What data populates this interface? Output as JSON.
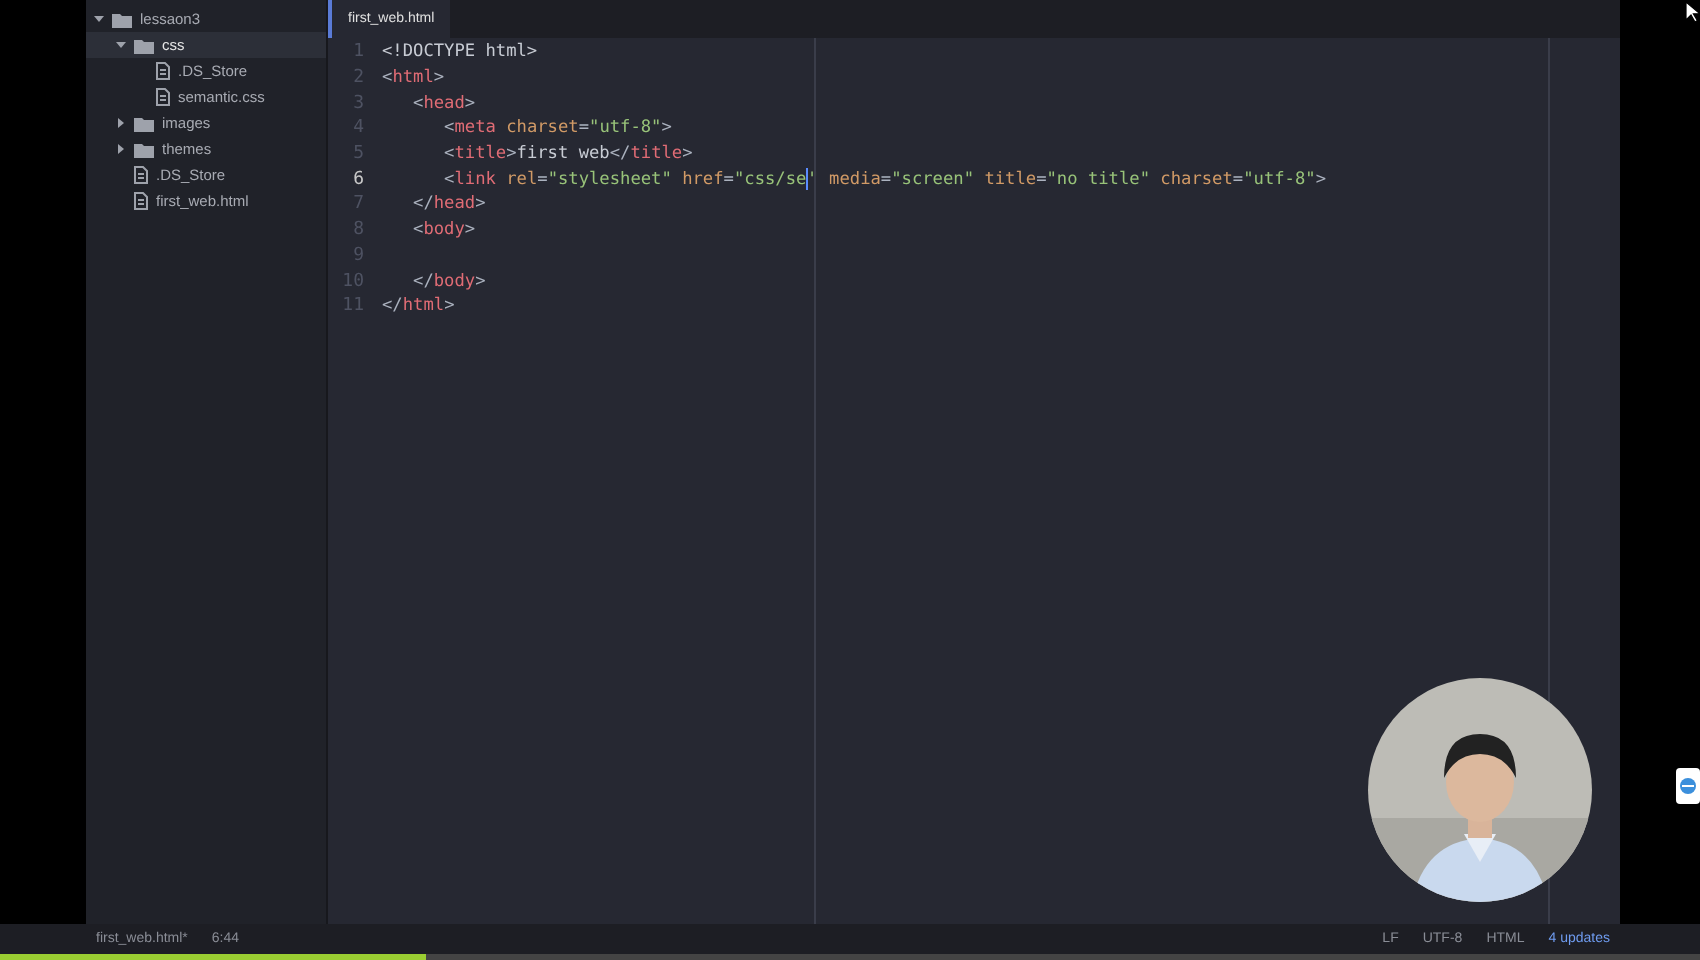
{
  "sidebar": {
    "tree": [
      {
        "label": "lessaon3",
        "kind": "folder",
        "expanded": true,
        "children": [
          {
            "label": "css",
            "kind": "folder",
            "expanded": true,
            "selected": true,
            "children": [
              {
                "label": ".DS_Store",
                "kind": "file",
                "selected": false
              },
              {
                "label": "semantic.css",
                "kind": "file",
                "selected": false
              }
            ]
          },
          {
            "label": "images",
            "kind": "folder",
            "expanded": false,
            "selected": false
          },
          {
            "label": "themes",
            "kind": "folder",
            "expanded": false,
            "selected": false
          },
          {
            "label": ".DS_Store",
            "kind": "file",
            "selected": false
          },
          {
            "label": "first_web.html",
            "kind": "file",
            "selected": false
          }
        ],
        "selected": false
      }
    ]
  },
  "tabs": [
    {
      "label": "first_web.html",
      "selected": true
    }
  ],
  "editor": {
    "lines": [
      {
        "number": "1",
        "selected": false,
        "tokens": [
          {
            "kind": "text",
            "text": "<!DOCTYPE html>"
          }
        ]
      },
      {
        "number": "2",
        "selected": false,
        "tokens": [
          {
            "kind": "punct",
            "text": "<"
          },
          {
            "kind": "tag",
            "text": "html"
          },
          {
            "kind": "punct",
            "text": ">"
          }
        ]
      },
      {
        "number": "3",
        "selected": false,
        "tokens": [
          {
            "kind": "punct",
            "text": "   <"
          },
          {
            "kind": "tag",
            "text": "head"
          },
          {
            "kind": "punct",
            "text": ">"
          }
        ]
      },
      {
        "number": "4",
        "selected": false,
        "tokens": [
          {
            "kind": "punct",
            "text": "      <"
          },
          {
            "kind": "tag",
            "text": "meta"
          },
          {
            "kind": "attr",
            "text": " charset"
          },
          {
            "kind": "punct",
            "text": "="
          },
          {
            "kind": "string",
            "text": "\"utf-8\""
          },
          {
            "kind": "punct",
            "text": ">"
          }
        ]
      },
      {
        "number": "5",
        "selected": false,
        "tokens": [
          {
            "kind": "punct",
            "text": "      <"
          },
          {
            "kind": "tag",
            "text": "title"
          },
          {
            "kind": "punct",
            "text": ">"
          },
          {
            "kind": "text",
            "text": "first web"
          },
          {
            "kind": "punct",
            "text": "</"
          },
          {
            "kind": "tag",
            "text": "title"
          },
          {
            "kind": "punct",
            "text": ">"
          }
        ]
      },
      {
        "number": "6",
        "selected": true,
        "tokens": [
          {
            "kind": "punct",
            "text": "      <"
          },
          {
            "kind": "tag",
            "text": "link"
          },
          {
            "kind": "attr",
            "text": " rel"
          },
          {
            "kind": "punct",
            "text": "="
          },
          {
            "kind": "string",
            "text": "\"stylesheet\""
          },
          {
            "kind": "attr",
            "text": " href"
          },
          {
            "kind": "punct",
            "text": "="
          },
          {
            "kind": "string",
            "text": "\"css/se",
            "cursor": true
          },
          {
            "kind": "string",
            "text": "\""
          },
          {
            "kind": "attr",
            "text": " media"
          },
          {
            "kind": "punct",
            "text": "="
          },
          {
            "kind": "string",
            "text": "\"screen\""
          },
          {
            "kind": "attr",
            "text": " title"
          },
          {
            "kind": "punct",
            "text": "="
          },
          {
            "kind": "string",
            "text": "\"no title\""
          },
          {
            "kind": "attr",
            "text": " charset"
          },
          {
            "kind": "punct",
            "text": "="
          },
          {
            "kind": "string",
            "text": "\"utf-8\""
          },
          {
            "kind": "punct",
            "text": ">"
          }
        ]
      },
      {
        "number": "7",
        "selected": false,
        "tokens": [
          {
            "kind": "punct",
            "text": "   </"
          },
          {
            "kind": "tag",
            "text": "head"
          },
          {
            "kind": "punct",
            "text": ">"
          }
        ]
      },
      {
        "number": "8",
        "selected": false,
        "tokens": [
          {
            "kind": "punct",
            "text": "   <"
          },
          {
            "kind": "tag",
            "text": "body"
          },
          {
            "kind": "punct",
            "text": ">"
          }
        ]
      },
      {
        "number": "9",
        "selected": false
      },
      {
        "number": "10",
        "selected": false,
        "tokens": [
          {
            "kind": "punct",
            "text": "   </"
          },
          {
            "kind": "tag",
            "text": "body"
          },
          {
            "kind": "punct",
            "text": ">"
          }
        ]
      },
      {
        "number": "11",
        "selected": false,
        "tokens": [
          {
            "kind": "punct",
            "text": "</"
          },
          {
            "kind": "tag",
            "text": "html"
          },
          {
            "kind": "punct",
            "text": ">"
          }
        ]
      }
    ]
  },
  "status_bar": {
    "file": "first_web.html*",
    "position": "6:44",
    "line_ending": "LF",
    "encoding": "UTF-8",
    "grammar": "HTML",
    "updates": "4 updates"
  },
  "player": {
    "level": 0.25
  }
}
